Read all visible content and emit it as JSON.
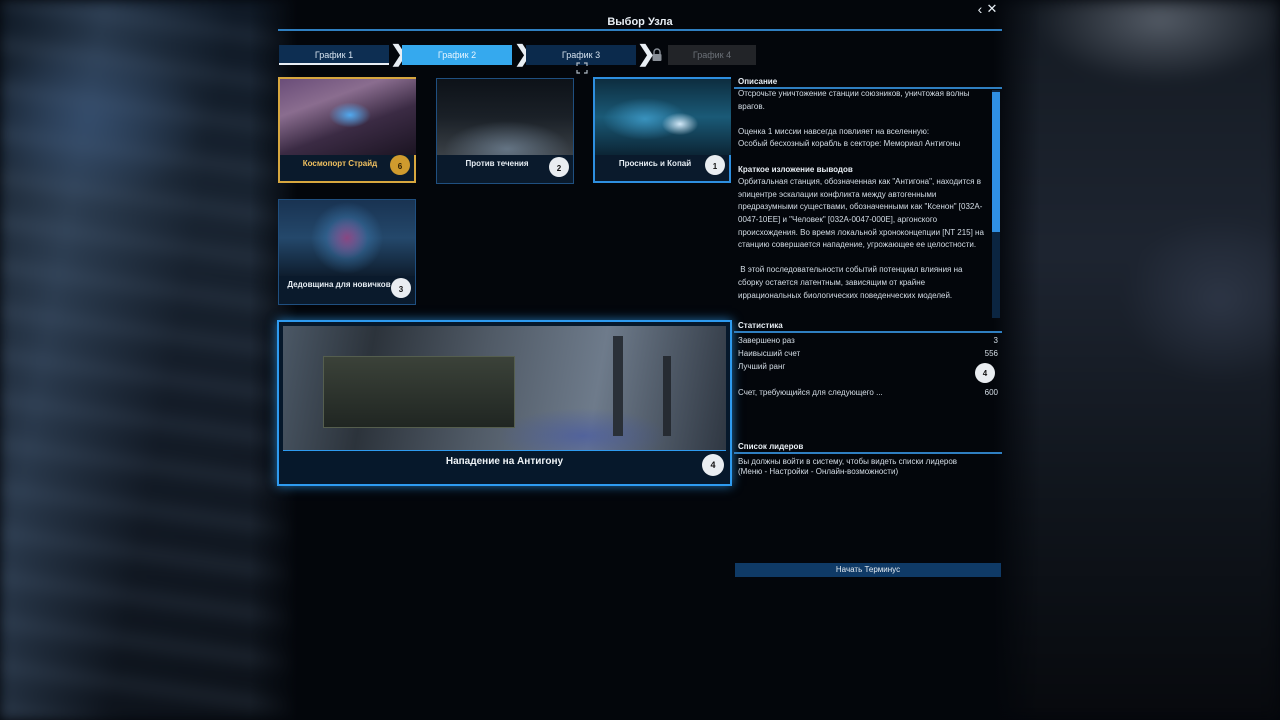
{
  "window": {
    "title": "Выбор Узла"
  },
  "nav": {
    "back_icon": "chevron-left-icon",
    "close_icon": "close-icon"
  },
  "tabs": [
    {
      "label": "График 1",
      "state": "normal"
    },
    {
      "label": "График 2",
      "state": "active"
    },
    {
      "label": "График 3",
      "state": "normal"
    },
    {
      "label": "График 4",
      "state": "locked"
    }
  ],
  "missions": [
    {
      "label": "Космопорт Страйд",
      "badge": "6",
      "state": "completed-gold"
    },
    {
      "label": "Против течения",
      "badge": "2",
      "state": "normal"
    },
    {
      "label": "Проснись и Копай",
      "badge": "1",
      "state": "blue"
    },
    {
      "label": "Дедовщина для новичков",
      "badge": "3",
      "state": "normal"
    }
  ],
  "selected_mission": {
    "label": "Нападение на Антигону",
    "badge": "4"
  },
  "description": {
    "title": "Описание",
    "paragraphs": [
      "Отсрочьте уничтожение станции союзников, уничтожая волны врагов.",
      "Оценка 1 миссии навсегда повлияет на вселенную:\nОсобый бесхозный корабль в секторе: Мемориал Антигоны"
    ],
    "summary_title": "Краткое изложение выводов",
    "summary_paragraphs": [
      "Орбитальная станция, обозначенная как \"Антигона\", находится в эпицентре эскалации конфликта между автогенными предразумными существами, обозначенными как \"Ксенон\" [032A-0047-10EE] и \"Человек\" [032A-0047-000E], аргонского происхождения. Во время локальной хроноконцепции [NT 215] на станцию совершается нападение, угрожающее ее целостности.",
      " В этой последовательности событий потенциал влияния на сборку остается латентным, зависящим от крайне иррациональных биологических поведенческих моделей."
    ]
  },
  "stats": {
    "title": "Статистика",
    "completed_label": "Завершено раз",
    "completed_value": "3",
    "high_score_label": "Наивысший счет",
    "high_score_value": "556",
    "best_rank_label": "Лучший ранг",
    "best_rank_badge": "4",
    "next_label": "Счет, требующийся для следующего ...",
    "next_value": "600"
  },
  "leaderboard": {
    "title": "Список лидеров",
    "message": "Вы должны войти в систему, чтобы видеть списки лидеров\n(Меню - Настройки - Онлайн-возможности)"
  },
  "start_button": "Начать Терминус",
  "colors": {
    "accent": "#2f7fc1",
    "active_tab": "#35a9ee",
    "gold": "#d7a73f"
  }
}
